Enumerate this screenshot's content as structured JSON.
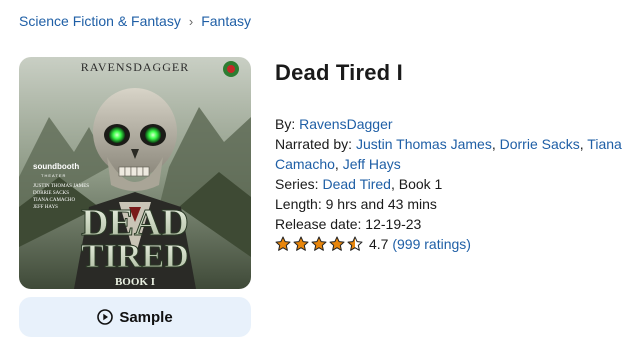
{
  "breadcrumb": {
    "category": "Science Fiction & Fantasy",
    "subcategory": "Fantasy"
  },
  "cover": {
    "author_text": "RAVENSDAGGER",
    "publisher_text": "soundbooth",
    "publisher_sub": "THEATER",
    "narrators_text": [
      "JUSTIN THOMAS JAMES",
      "DORRIE SACKS",
      "TIANA CAMACHO",
      "JEFF HAYS"
    ],
    "title_line1": "DEAD",
    "title_line2": "TIRED",
    "book_text": "BOOK I"
  },
  "sample_button": {
    "label": "Sample"
  },
  "book": {
    "title": "Dead Tired I",
    "by_label": "By: ",
    "author": "RavensDagger",
    "narrated_label": "Narrated by: ",
    "narrators": [
      "Justin Thomas James",
      "Dorrie Sacks",
      "Tiana Camacho",
      "Jeff Hays"
    ],
    "series_label": "Series: ",
    "series_name": "Dead Tired",
    "series_suffix": ", Book 1",
    "length_label": "Length: ",
    "length": "9 hrs and 43 mins",
    "release_label": "Release date: ",
    "release_date": "12-19-23",
    "rating_value": "4.7",
    "rating_count": "(999 ratings)",
    "stars": 4.5
  },
  "colors": {
    "link": "#1f5fa6",
    "star": "#e8860c",
    "sample_bg": "#e8f1fb"
  }
}
